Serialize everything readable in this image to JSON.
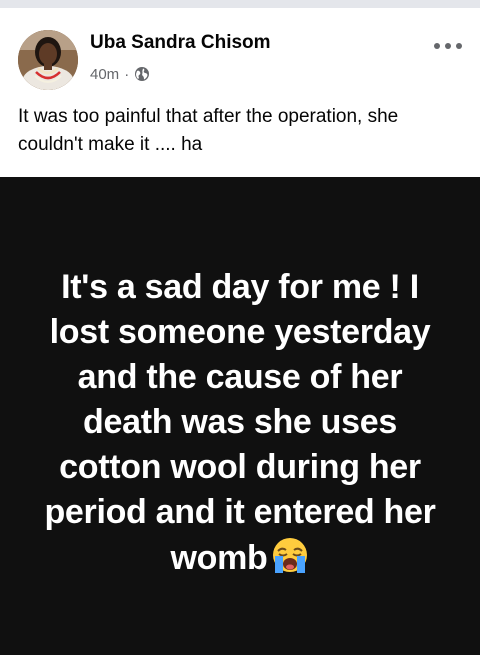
{
  "post": {
    "author": "Uba Sandra Chisom",
    "time": "40m",
    "separator": "·",
    "privacy_icon": "globe-icon",
    "more_icon": "more-options-icon",
    "caption": "It was too painful that after the operation, she couldn't make it .... ha",
    "image_text": "It's a sad day for me ! I lost someone yesterday and the cause of her death was she uses cotton wool during her period and it entered her womb",
    "image_emoji": "loudly-crying-face-emoji"
  },
  "colors": {
    "name": "#050505",
    "meta": "#65676b",
    "image_background": "#101010",
    "image_text": "#ffffff",
    "divider": "#e4e6eb"
  }
}
